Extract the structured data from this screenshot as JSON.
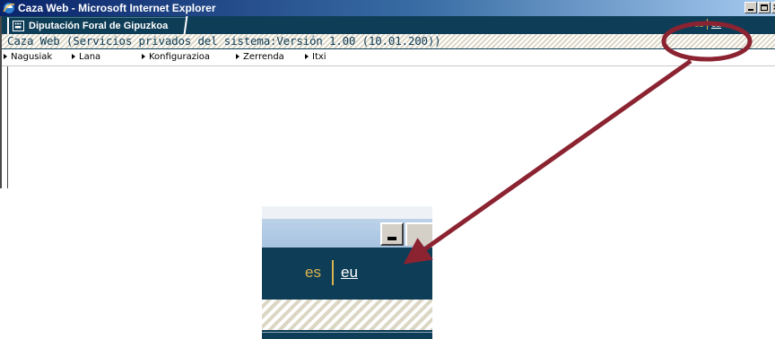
{
  "window": {
    "title": "Caza Web - Microsoft Internet Explorer",
    "org_tab": "Diputación Foral de Gipuzkoa",
    "app_title": "Caza Web (Servicios privados del sistema:Versión 1.00 (10.01.200))",
    "languages": {
      "es": "es",
      "eu": "eu"
    }
  },
  "menu": {
    "items": [
      {
        "label": "Nagusiak"
      },
      {
        "label": "Lana"
      },
      {
        "label": "Konfigurazioa"
      },
      {
        "label": "Zerrenda"
      },
      {
        "label": "Itxi"
      }
    ]
  },
  "zoom": {
    "languages": {
      "es": "es",
      "eu": "eu"
    }
  },
  "colors": {
    "header_bg": "#0e3d57",
    "lang_active": "#d9b34c",
    "annotation": "#8b2331"
  },
  "icons": {
    "app": "ie-icon",
    "org": "dfg-logo-icon",
    "menu": "triangle-right-icon"
  }
}
